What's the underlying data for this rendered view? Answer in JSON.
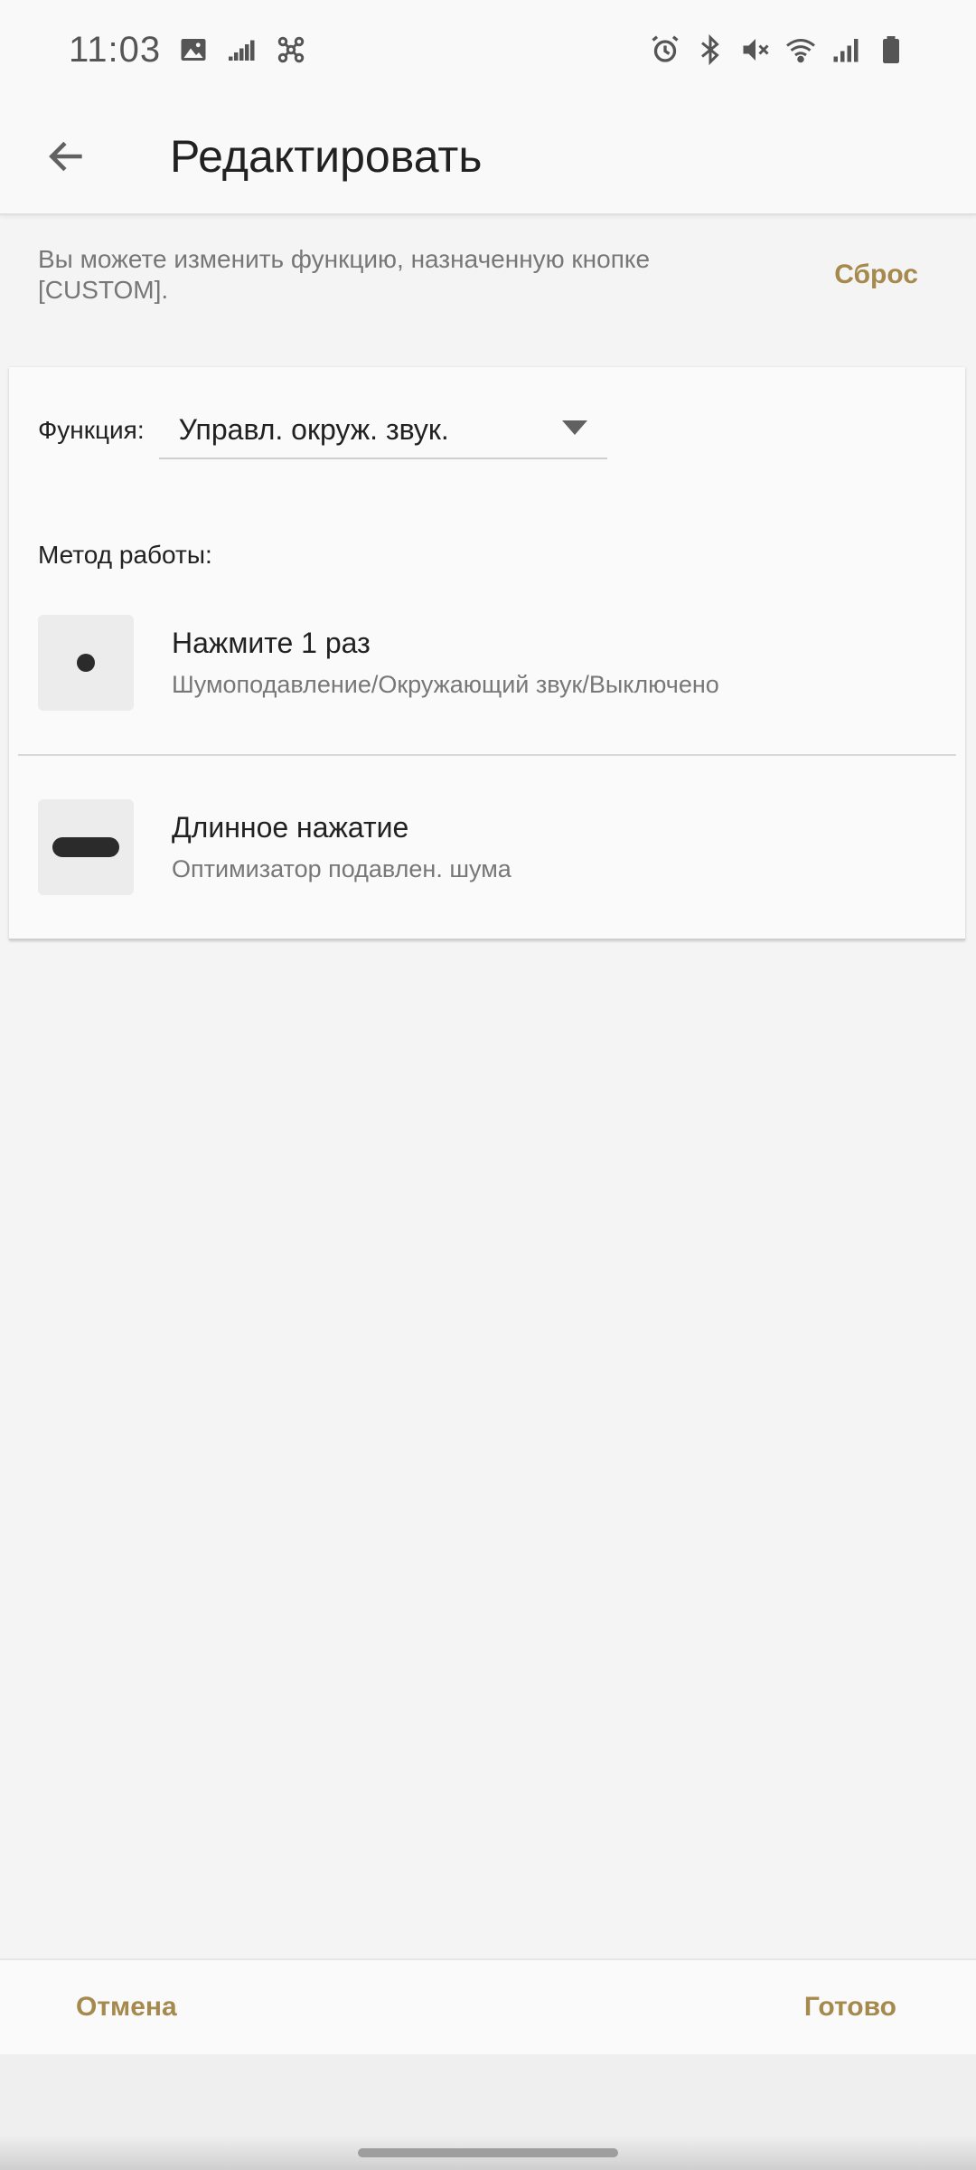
{
  "status_bar": {
    "time": "11:03",
    "left_icons": [
      "image-icon",
      "equalizer-icon",
      "network-icon"
    ],
    "right_icons": [
      "alarm-icon",
      "bluetooth-icon",
      "mute-icon",
      "wifi-icon",
      "signal-icon",
      "battery-icon"
    ]
  },
  "app_bar": {
    "title": "Редактировать"
  },
  "description": {
    "text": "Вы можете изменить функцию, назначенную кнопке [CUSTOM].",
    "reset_label": "Сброс"
  },
  "card": {
    "function_label": "Функция:",
    "function_value": "Управл. окруж. звук.",
    "method_label": "Метод работы:",
    "methods": [
      {
        "title": "Нажмите 1 раз",
        "subtitle": "Шумоподавление/Окружающий звук/Выключено",
        "icon": "single-press-icon"
      },
      {
        "title": "Длинное нажатие",
        "subtitle": "Оптимизатор подавлен. шума",
        "icon": "long-press-icon"
      }
    ]
  },
  "bottom": {
    "cancel_label": "Отмена",
    "done_label": "Готово"
  },
  "colors": {
    "accent": "#a6894d",
    "background": "#f4f4f4",
    "card": "#fafafa"
  }
}
